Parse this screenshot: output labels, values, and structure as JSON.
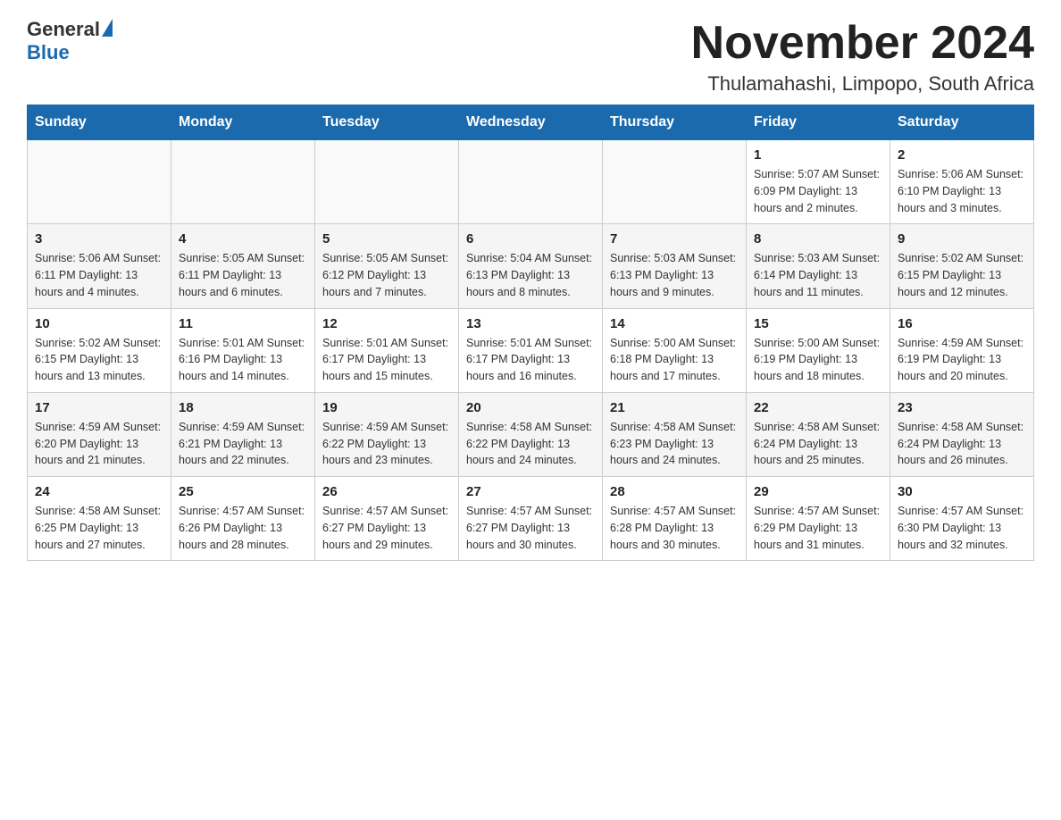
{
  "header": {
    "logo_general": "General",
    "logo_blue": "Blue",
    "title": "November 2024",
    "subtitle": "Thulamahashi, Limpopo, South Africa"
  },
  "weekdays": [
    "Sunday",
    "Monday",
    "Tuesday",
    "Wednesday",
    "Thursday",
    "Friday",
    "Saturday"
  ],
  "weeks": [
    [
      {
        "day": "",
        "info": ""
      },
      {
        "day": "",
        "info": ""
      },
      {
        "day": "",
        "info": ""
      },
      {
        "day": "",
        "info": ""
      },
      {
        "day": "",
        "info": ""
      },
      {
        "day": "1",
        "info": "Sunrise: 5:07 AM\nSunset: 6:09 PM\nDaylight: 13 hours\nand 2 minutes."
      },
      {
        "day": "2",
        "info": "Sunrise: 5:06 AM\nSunset: 6:10 PM\nDaylight: 13 hours\nand 3 minutes."
      }
    ],
    [
      {
        "day": "3",
        "info": "Sunrise: 5:06 AM\nSunset: 6:11 PM\nDaylight: 13 hours\nand 4 minutes."
      },
      {
        "day": "4",
        "info": "Sunrise: 5:05 AM\nSunset: 6:11 PM\nDaylight: 13 hours\nand 6 minutes."
      },
      {
        "day": "5",
        "info": "Sunrise: 5:05 AM\nSunset: 6:12 PM\nDaylight: 13 hours\nand 7 minutes."
      },
      {
        "day": "6",
        "info": "Sunrise: 5:04 AM\nSunset: 6:13 PM\nDaylight: 13 hours\nand 8 minutes."
      },
      {
        "day": "7",
        "info": "Sunrise: 5:03 AM\nSunset: 6:13 PM\nDaylight: 13 hours\nand 9 minutes."
      },
      {
        "day": "8",
        "info": "Sunrise: 5:03 AM\nSunset: 6:14 PM\nDaylight: 13 hours\nand 11 minutes."
      },
      {
        "day": "9",
        "info": "Sunrise: 5:02 AM\nSunset: 6:15 PM\nDaylight: 13 hours\nand 12 minutes."
      }
    ],
    [
      {
        "day": "10",
        "info": "Sunrise: 5:02 AM\nSunset: 6:15 PM\nDaylight: 13 hours\nand 13 minutes."
      },
      {
        "day": "11",
        "info": "Sunrise: 5:01 AM\nSunset: 6:16 PM\nDaylight: 13 hours\nand 14 minutes."
      },
      {
        "day": "12",
        "info": "Sunrise: 5:01 AM\nSunset: 6:17 PM\nDaylight: 13 hours\nand 15 minutes."
      },
      {
        "day": "13",
        "info": "Sunrise: 5:01 AM\nSunset: 6:17 PM\nDaylight: 13 hours\nand 16 minutes."
      },
      {
        "day": "14",
        "info": "Sunrise: 5:00 AM\nSunset: 6:18 PM\nDaylight: 13 hours\nand 17 minutes."
      },
      {
        "day": "15",
        "info": "Sunrise: 5:00 AM\nSunset: 6:19 PM\nDaylight: 13 hours\nand 18 minutes."
      },
      {
        "day": "16",
        "info": "Sunrise: 4:59 AM\nSunset: 6:19 PM\nDaylight: 13 hours\nand 20 minutes."
      }
    ],
    [
      {
        "day": "17",
        "info": "Sunrise: 4:59 AM\nSunset: 6:20 PM\nDaylight: 13 hours\nand 21 minutes."
      },
      {
        "day": "18",
        "info": "Sunrise: 4:59 AM\nSunset: 6:21 PM\nDaylight: 13 hours\nand 22 minutes."
      },
      {
        "day": "19",
        "info": "Sunrise: 4:59 AM\nSunset: 6:22 PM\nDaylight: 13 hours\nand 23 minutes."
      },
      {
        "day": "20",
        "info": "Sunrise: 4:58 AM\nSunset: 6:22 PM\nDaylight: 13 hours\nand 24 minutes."
      },
      {
        "day": "21",
        "info": "Sunrise: 4:58 AM\nSunset: 6:23 PM\nDaylight: 13 hours\nand 24 minutes."
      },
      {
        "day": "22",
        "info": "Sunrise: 4:58 AM\nSunset: 6:24 PM\nDaylight: 13 hours\nand 25 minutes."
      },
      {
        "day": "23",
        "info": "Sunrise: 4:58 AM\nSunset: 6:24 PM\nDaylight: 13 hours\nand 26 minutes."
      }
    ],
    [
      {
        "day": "24",
        "info": "Sunrise: 4:58 AM\nSunset: 6:25 PM\nDaylight: 13 hours\nand 27 minutes."
      },
      {
        "day": "25",
        "info": "Sunrise: 4:57 AM\nSunset: 6:26 PM\nDaylight: 13 hours\nand 28 minutes."
      },
      {
        "day": "26",
        "info": "Sunrise: 4:57 AM\nSunset: 6:27 PM\nDaylight: 13 hours\nand 29 minutes."
      },
      {
        "day": "27",
        "info": "Sunrise: 4:57 AM\nSunset: 6:27 PM\nDaylight: 13 hours\nand 30 minutes."
      },
      {
        "day": "28",
        "info": "Sunrise: 4:57 AM\nSunset: 6:28 PM\nDaylight: 13 hours\nand 30 minutes."
      },
      {
        "day": "29",
        "info": "Sunrise: 4:57 AM\nSunset: 6:29 PM\nDaylight: 13 hours\nand 31 minutes."
      },
      {
        "day": "30",
        "info": "Sunrise: 4:57 AM\nSunset: 6:30 PM\nDaylight: 13 hours\nand 32 minutes."
      }
    ]
  ]
}
